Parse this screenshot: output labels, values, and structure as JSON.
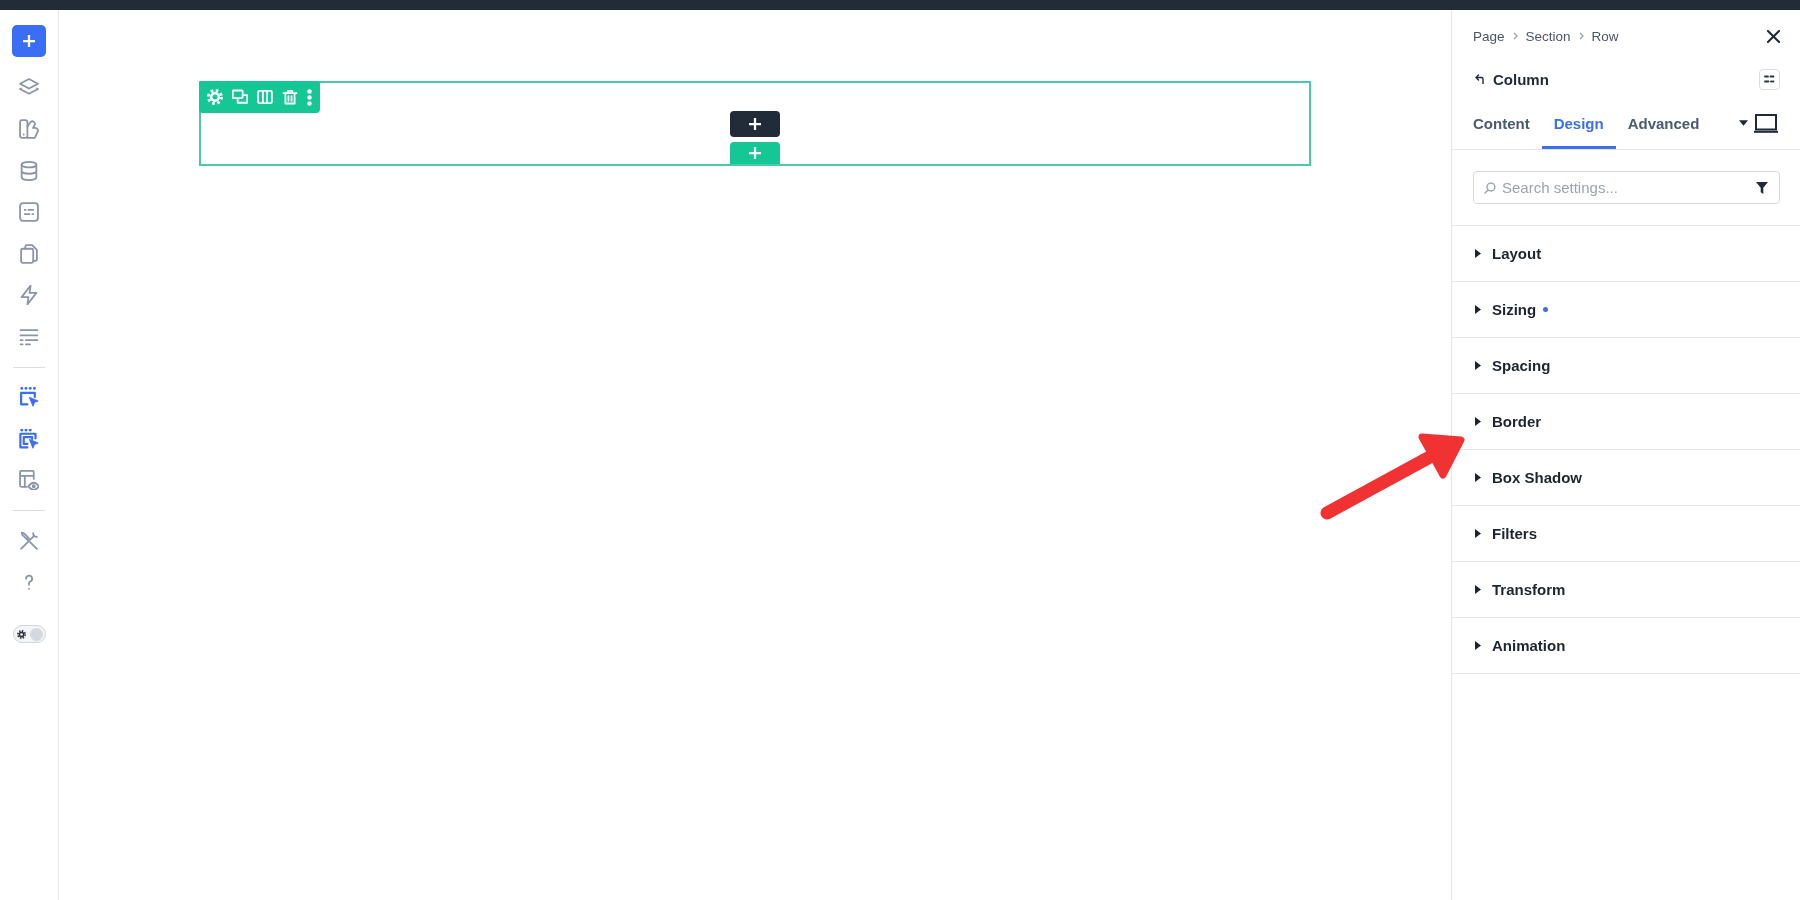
{
  "sidebar": {
    "groups": [
      [
        {
          "kind": "layers",
          "active": false
        },
        {
          "kind": "shapes",
          "active": false
        },
        {
          "kind": "database",
          "active": false
        },
        {
          "kind": "form",
          "active": false
        },
        {
          "kind": "pages",
          "active": false
        },
        {
          "kind": "bolt",
          "active": false
        },
        {
          "kind": "rows",
          "active": false
        }
      ],
      [
        {
          "kind": "select",
          "active": true
        },
        {
          "kind": "select-multi",
          "active": true
        },
        {
          "kind": "template-preview",
          "active": false
        }
      ],
      [
        {
          "kind": "tools",
          "active": false
        },
        {
          "kind": "help",
          "active": false
        }
      ]
    ],
    "theme_toggle": {
      "on": true
    }
  },
  "canvas": {
    "row": {
      "toolbar": [
        {
          "kind": "settings"
        },
        {
          "kind": "duplicate"
        },
        {
          "kind": "columns"
        },
        {
          "kind": "delete"
        },
        {
          "kind": "more"
        }
      ]
    }
  },
  "panel": {
    "breadcrumb": [
      "Page",
      "Section",
      "Row"
    ],
    "title": "Column",
    "tabs": [
      {
        "label": "Content",
        "selected": false
      },
      {
        "label": "Design",
        "selected": true
      },
      {
        "label": "Advanced",
        "selected": false
      }
    ],
    "search": {
      "placeholder": "Search settings..."
    },
    "sections": [
      {
        "label": "Layout",
        "expanded": false,
        "modified": false
      },
      {
        "label": "Sizing",
        "expanded": false,
        "modified": true
      },
      {
        "label": "Spacing",
        "expanded": false,
        "modified": false
      },
      {
        "label": "Border",
        "expanded": false,
        "modified": false
      },
      {
        "label": "Box Shadow",
        "expanded": false,
        "modified": false
      },
      {
        "label": "Filters",
        "expanded": false,
        "modified": false
      },
      {
        "label": "Transform",
        "expanded": false,
        "modified": false
      },
      {
        "label": "Animation",
        "expanded": false,
        "modified": false
      }
    ]
  }
}
